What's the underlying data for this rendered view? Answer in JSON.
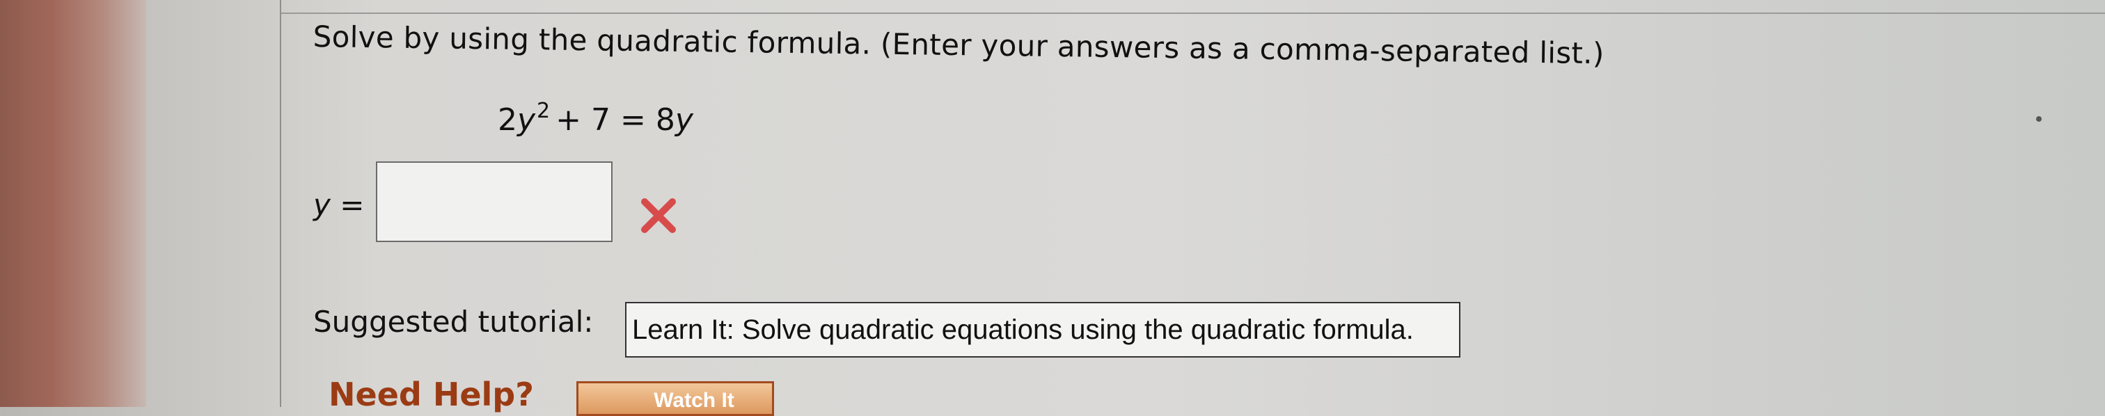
{
  "question": {
    "text": "Solve by using the quadratic formula. (Enter your answers as a comma-separated list.)"
  },
  "equation": {
    "coefficient": "2",
    "variable": "y",
    "exponent": "2",
    "rest": "+ 7 =",
    "rhs_coefficient": "8",
    "rhs_variable": "y"
  },
  "answer": {
    "variable": "y",
    "equals": "=",
    "value": "",
    "status_icon": "red-x-icon",
    "status_color": "#d84b4b"
  },
  "tutorial": {
    "label": "Suggested tutorial:",
    "button_label": "Learn It: Solve quadratic equations using the quadratic formula."
  },
  "help": {
    "label": "Need Help?",
    "watch_label": "Watch It"
  }
}
